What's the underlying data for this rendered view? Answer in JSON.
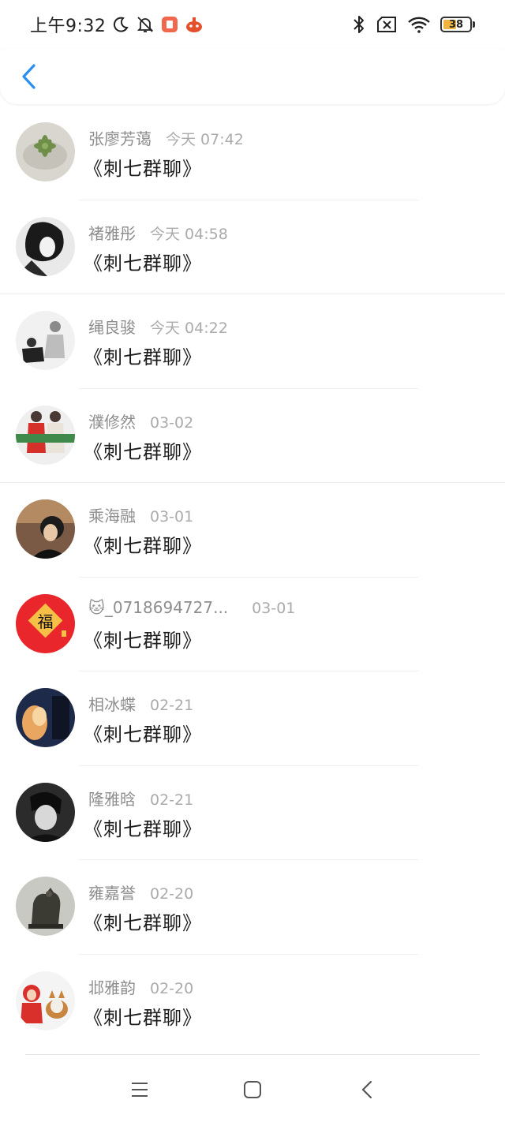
{
  "status_bar": {
    "time": "上午9:32",
    "battery_level": "38",
    "battery_color": "#f2b441",
    "left_icons": [
      "moon-icon",
      "mute-bell-icon",
      "app-notification-icon",
      "game-notification-icon"
    ],
    "right_icons": [
      "bluetooth-icon",
      "no-sim-icon",
      "wifi-icon",
      "battery-icon"
    ]
  },
  "header": {
    "back_icon": "chevron-left-icon",
    "accent": "#2b8ff0"
  },
  "messages": [
    {
      "name": "张廖芳蔼",
      "time": "今天 07:42",
      "text": "《刺七群聊》"
    },
    {
      "name": "褚雅彤",
      "time": "今天 04:58",
      "text": "《刺七群聊》"
    },
    {
      "name": "绳良骏",
      "time": "今天 04:22",
      "text": "《刺七群聊》"
    },
    {
      "name": "濮修然",
      "time": "03-02",
      "text": "《刺七群聊》"
    },
    {
      "name": "乘海融",
      "time": "03-01",
      "text": "《刺七群聊》"
    },
    {
      "name": "🐱_0718694727...",
      "time": "03-01",
      "text": "《刺七群聊》"
    },
    {
      "name": "相冰蝶",
      "time": "02-21",
      "text": "《刺七群聊》"
    },
    {
      "name": "隆雅晗",
      "time": "02-21",
      "text": "《刺七群聊》"
    },
    {
      "name": "雍嘉誉",
      "time": "02-20",
      "text": "《刺七群聊》"
    },
    {
      "name": "邶雅韵",
      "time": "02-20",
      "text": "《刺七群聊》"
    }
  ],
  "nav_bar": {
    "icons": [
      "menu-icon",
      "home-square-icon",
      "back-triangle-icon"
    ]
  }
}
